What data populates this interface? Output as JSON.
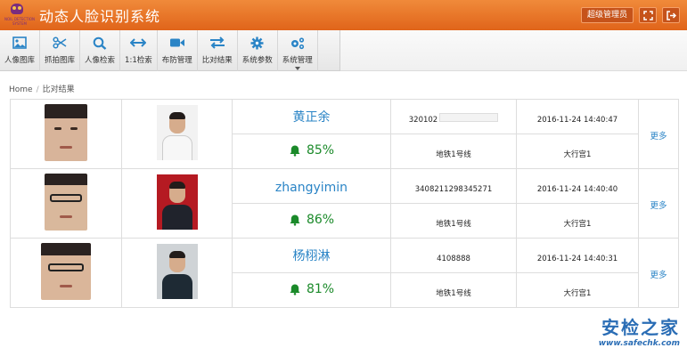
{
  "header": {
    "logo_text": "NOIL DETECTION SYSTEM",
    "title": "动态人脸识别系统",
    "admin_label": "超级管理员",
    "icons": [
      "fullscreen-icon",
      "logout-icon"
    ]
  },
  "toolbar": {
    "items": [
      {
        "label": "人像图库",
        "icon": "image-icon"
      },
      {
        "label": "抓拍图库",
        "icon": "scissors-icon"
      },
      {
        "label": "人像检索",
        "icon": "search-icon"
      },
      {
        "label": "1:1检索",
        "icon": "compare-arrows-icon"
      },
      {
        "label": "布防管理",
        "icon": "video-camera-icon"
      },
      {
        "label": "比对结果",
        "icon": "swap-arrows-icon"
      },
      {
        "label": "系统参数",
        "icon": "gear-icon"
      },
      {
        "label": "系统管理",
        "icon": "gears-icon"
      }
    ],
    "active_index": 5
  },
  "breadcrumb": {
    "home": "Home",
    "current": "比对结果"
  },
  "results": [
    {
      "name": "黄正余",
      "score": "85%",
      "id": "320102",
      "id_masked": true,
      "time": "2016-11-24 14:40:47",
      "line": "地铁1号线",
      "place": "大行宫1",
      "more": "更多"
    },
    {
      "name": "zhangyimin",
      "score": "86%",
      "id": "3408211298345271",
      "id_masked": false,
      "time": "2016-11-24 14:40:40",
      "line": "地铁1号线",
      "place": "大行宫1",
      "more": "更多"
    },
    {
      "name": "杨栩淋",
      "score": "81%",
      "id": "4108888",
      "id_masked": false,
      "time": "2016-11-24 14:40:31",
      "line": "地铁1号线",
      "place": "大行宫1",
      "more": "更多"
    }
  ],
  "watermark": {
    "main": "安检之家",
    "url": "www.safechk.com"
  },
  "colors": {
    "header": "#e9762a",
    "link": "#2a84c6",
    "score": "#1b8a2a",
    "watermark": "#2a6db5"
  }
}
